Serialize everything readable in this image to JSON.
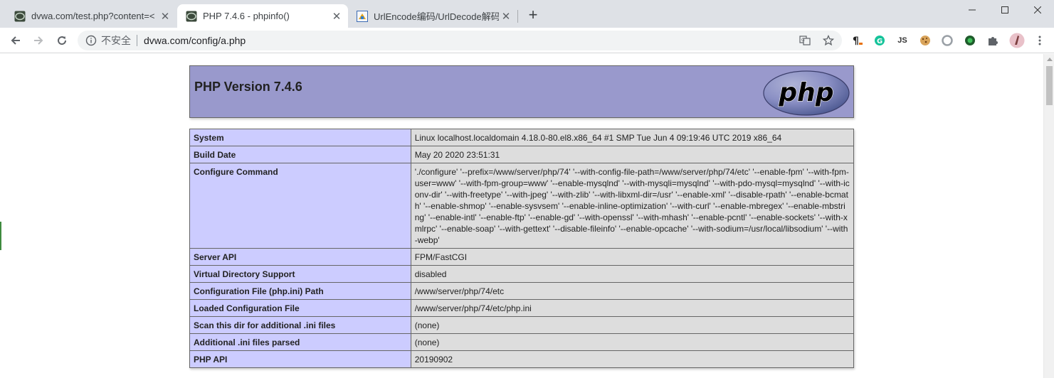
{
  "browser": {
    "tabs": [
      {
        "title": "dvwa.com/test.php?content=<",
        "active": false
      },
      {
        "title": "PHP 7.4.6 - phpinfo()",
        "active": true
      },
      {
        "title": "UrlEncode编码/UrlDecode解码",
        "active": false
      }
    ],
    "address": {
      "security_label": "不安全",
      "url": "dvwa.com/config/a.php"
    },
    "extensions": {
      "js_label": "JS"
    }
  },
  "phpinfo": {
    "header_title": "PHP Version 7.4.6",
    "logo_text": "php",
    "rows": [
      {
        "key": "System",
        "value": "Linux localhost.localdomain 4.18.0-80.el8.x86_64 #1 SMP Tue Jun 4 09:19:46 UTC 2019 x86_64"
      },
      {
        "key": "Build Date",
        "value": "May 20 2020 23:51:31"
      },
      {
        "key": "Configure Command",
        "value": "'./configure' '--prefix=/www/server/php/74' '--with-config-file-path=/www/server/php/74/etc' '--enable-fpm' '--with-fpm-user=www' '--with-fpm-group=www' '--enable-mysqlnd' '--with-mysqli=mysqlnd' '--with-pdo-mysql=mysqlnd' '--with-iconv-dir' '--with-freetype' '--with-jpeg' '--with-zlib' '--with-libxml-dir=/usr' '--enable-xml' '--disable-rpath' '--enable-bcmath' '--enable-shmop' '--enable-sysvsem' '--enable-inline-optimization' '--with-curl' '--enable-mbregex' '--enable-mbstring' '--enable-intl' '--enable-ftp' '--enable-gd' '--with-openssl' '--with-mhash' '--enable-pcntl' '--enable-sockets' '--with-xmlrpc' '--enable-soap' '--with-gettext' '--disable-fileinfo' '--enable-opcache' '--with-sodium=/usr/local/libsodium' '--with-webp'"
      },
      {
        "key": "Server API",
        "value": "FPM/FastCGI"
      },
      {
        "key": "Virtual Directory Support",
        "value": "disabled"
      },
      {
        "key": "Configuration File (php.ini) Path",
        "value": "/www/server/php/74/etc"
      },
      {
        "key": "Loaded Configuration File",
        "value": "/www/server/php/74/etc/php.ini"
      },
      {
        "key": "Scan this dir for additional .ini files",
        "value": "(none)"
      },
      {
        "key": "Additional .ini files parsed",
        "value": "(none)"
      },
      {
        "key": "PHP API",
        "value": "20190902"
      }
    ]
  },
  "colors": {
    "header_bg": "#9999cc",
    "key_cell_bg": "#ccccff",
    "value_cell_bg": "#dddddd",
    "tabstrip_bg": "#dee1e6"
  }
}
